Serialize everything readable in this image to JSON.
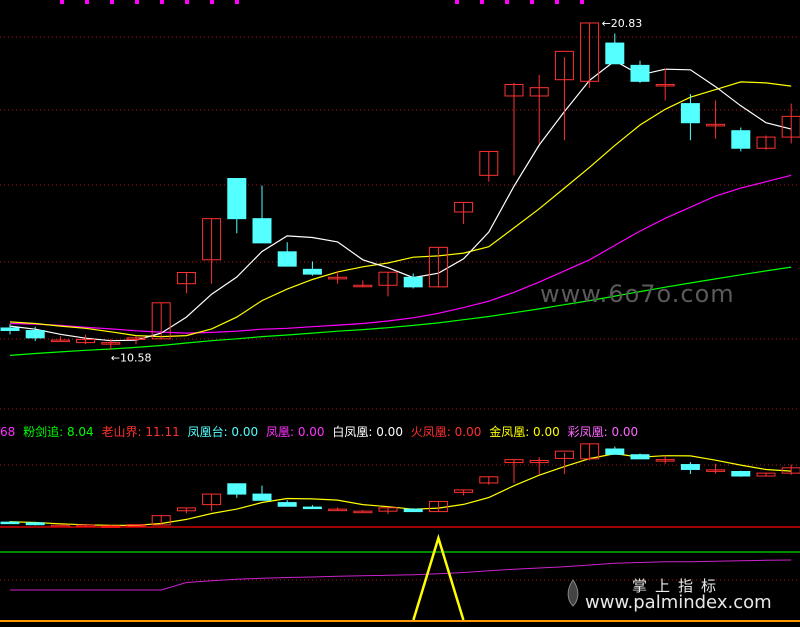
{
  "colors": {
    "background": "#000000",
    "up": "#ff3232",
    "down": "#54ffff",
    "ma5": "#ffffff",
    "ma10": "#ffff00",
    "ma20": "#ff00ff",
    "ma60": "#00ff00",
    "grid": "#b4141e",
    "pink_marker": "#ff00ff",
    "line_red": "#ff0000",
    "line_green": "#00dd00",
    "line_yellow": "#ffff00"
  },
  "chart_data": [
    {
      "type": "candlestick",
      "title": "",
      "grid": true,
      "ylim": [
        9.0,
        21.3
      ],
      "high_marker": "20.83",
      "low_marker": "10.58",
      "candles": [
        {
          "o": 11.26,
          "h": 11.38,
          "l": 11.06,
          "c": 11.18
        },
        {
          "o": 11.18,
          "h": 11.3,
          "l": 10.85,
          "c": 10.95
        },
        {
          "o": 10.88,
          "h": 11.0,
          "l": 10.85,
          "c": 10.88
        },
        {
          "o": 10.8,
          "h": 11.05,
          "l": 10.75,
          "c": 10.9
        },
        {
          "o": 10.8,
          "h": 10.92,
          "l": 10.58,
          "c": 10.8
        },
        {
          "o": 10.9,
          "h": 11.0,
          "l": 10.75,
          "c": 10.95
        },
        {
          "o": 10.92,
          "h": 12.05,
          "l": 10.9,
          "c": 12.05
        },
        {
          "o": 12.65,
          "h": 13.0,
          "l": 12.35,
          "c": 13.0
        },
        {
          "o": 13.4,
          "h": 14.69,
          "l": 12.65,
          "c": 14.69
        },
        {
          "o": 15.95,
          "h": 15.95,
          "l": 14.23,
          "c": 14.69
        },
        {
          "o": 14.69,
          "h": 15.73,
          "l": 13.93,
          "c": 13.93
        },
        {
          "o": 13.65,
          "h": 13.95,
          "l": 13.2,
          "c": 13.2
        },
        {
          "o": 13.1,
          "h": 13.35,
          "l": 12.9,
          "c": 12.95
        },
        {
          "o": 12.8,
          "h": 13.05,
          "l": 12.65,
          "c": 12.85
        },
        {
          "o": 12.6,
          "h": 12.75,
          "l": 12.55,
          "c": 12.6
        },
        {
          "o": 12.6,
          "h": 13.01,
          "l": 12.25,
          "c": 13.01
        },
        {
          "o": 12.85,
          "h": 12.97,
          "l": 12.5,
          "c": 12.55
        },
        {
          "o": 12.55,
          "h": 13.79,
          "l": 12.53,
          "c": 13.79
        },
        {
          "o": 14.9,
          "h": 15.2,
          "l": 14.52,
          "c": 15.2
        },
        {
          "o": 16.05,
          "h": 16.8,
          "l": 15.85,
          "c": 16.8
        },
        {
          "o": 18.54,
          "h": 18.95,
          "l": 16.05,
          "c": 18.9
        },
        {
          "o": 18.54,
          "h": 19.2,
          "l": 17.05,
          "c": 18.8
        },
        {
          "o": 19.05,
          "h": 19.75,
          "l": 17.15,
          "c": 19.94
        },
        {
          "o": 19.0,
          "h": 20.83,
          "l": 18.8,
          "c": 20.83
        },
        {
          "o": 20.2,
          "h": 20.5,
          "l": 19.65,
          "c": 19.55
        },
        {
          "o": 19.5,
          "h": 19.65,
          "l": 18.95,
          "c": 19.0
        },
        {
          "o": 18.9,
          "h": 19.4,
          "l": 18.4,
          "c": 18.9
        },
        {
          "o": 18.3,
          "h": 18.6,
          "l": 17.15,
          "c": 17.7
        },
        {
          "o": 17.6,
          "h": 18.4,
          "l": 17.2,
          "c": 17.65
        },
        {
          "o": 17.45,
          "h": 17.55,
          "l": 16.8,
          "c": 16.9
        },
        {
          "o": 16.9,
          "h": 17.3,
          "l": 16.85,
          "c": 17.25
        },
        {
          "o": 17.25,
          "h": 18.3,
          "l": 17.05,
          "c": 17.9
        }
      ],
      "ma5": [
        11.32,
        11.22,
        11.06,
        10.94,
        10.86,
        10.88,
        11.1,
        11.6,
        12.32,
        12.86,
        13.66,
        14.15,
        14.1,
        13.96,
        13.4,
        13.15,
        12.84,
        12.98,
        13.43,
        14.27,
        15.71,
        17.0,
        18.05,
        19.03,
        19.64,
        19.2,
        19.38,
        19.36,
        18.83,
        18.23,
        17.7,
        17.5
      ],
      "ma10": [
        11.45,
        11.4,
        11.32,
        11.25,
        11.14,
        11.02,
        10.99,
        11.02,
        11.23,
        11.6,
        12.12,
        12.48,
        12.78,
        13.02,
        13.18,
        13.3,
        13.48,
        13.52,
        13.61,
        13.81,
        14.4,
        15.0,
        15.65,
        16.3,
        16.99,
        17.63,
        18.12,
        18.5,
        18.74,
        18.98,
        18.95,
        18.85
      ],
      "ma20": [
        11.4,
        11.38,
        11.34,
        11.28,
        11.23,
        11.17,
        11.13,
        11.1,
        11.12,
        11.16,
        11.22,
        11.25,
        11.3,
        11.35,
        11.4,
        11.48,
        11.58,
        11.72,
        11.9,
        12.1,
        12.38,
        12.7,
        13.05,
        13.4,
        13.85,
        14.3,
        14.7,
        15.05,
        15.4,
        15.65,
        15.85,
        16.05
      ],
      "ma60": [
        10.4,
        10.46,
        10.51,
        10.56,
        10.6,
        10.65,
        10.71,
        10.79,
        10.86,
        10.92,
        10.99,
        11.04,
        11.1,
        11.16,
        11.21,
        11.27,
        11.34,
        11.42,
        11.52,
        11.62,
        11.74,
        11.86,
        11.99,
        12.12,
        12.26,
        12.4,
        12.54,
        12.67,
        12.8,
        12.93,
        13.05,
        13.17
      ]
    },
    {
      "type": "indicator",
      "title": "",
      "legend": [
        {
          "label": "粉剑追: 8.04",
          "color": "#00ff00"
        },
        {
          "label": "老山界: 11.11",
          "color": "#ff3030"
        },
        {
          "label": "凤凰台: 0.00",
          "color": "#54ffff"
        },
        {
          "label": "凤凰: 0.00",
          "color": "#ff33ff"
        },
        {
          "label": "白凤凰: 0.00",
          "color": "#ffffff"
        },
        {
          "label": "火凤凰: 0.00",
          "color": "#ff3030"
        },
        {
          "label": "金凤凰: 0.00",
          "color": "#ffff00"
        },
        {
          "label": "彩凤凰: 0.00",
          "color": "#ff66ff"
        }
      ],
      "legend_prefix": "68",
      "red_level": 11.11,
      "green_level": 8.04,
      "spike_index": 17,
      "pink_line": [
        9.3,
        9.3,
        9.3,
        9.3,
        9.3,
        9.3,
        9.3,
        9.75,
        9.85,
        9.95,
        10.0,
        10.05,
        10.08,
        10.12,
        10.15,
        10.18,
        10.22,
        10.28,
        10.35,
        10.45,
        10.55,
        10.62,
        10.7,
        10.8,
        10.9,
        10.95,
        11.0,
        11.0,
        11.02,
        11.05,
        11.08,
        11.1
      ]
    }
  ],
  "watermarks": {
    "site1": "www.6o7o.com",
    "brand_cn": "掌上指标",
    "site2": "www.palmindex.com"
  }
}
